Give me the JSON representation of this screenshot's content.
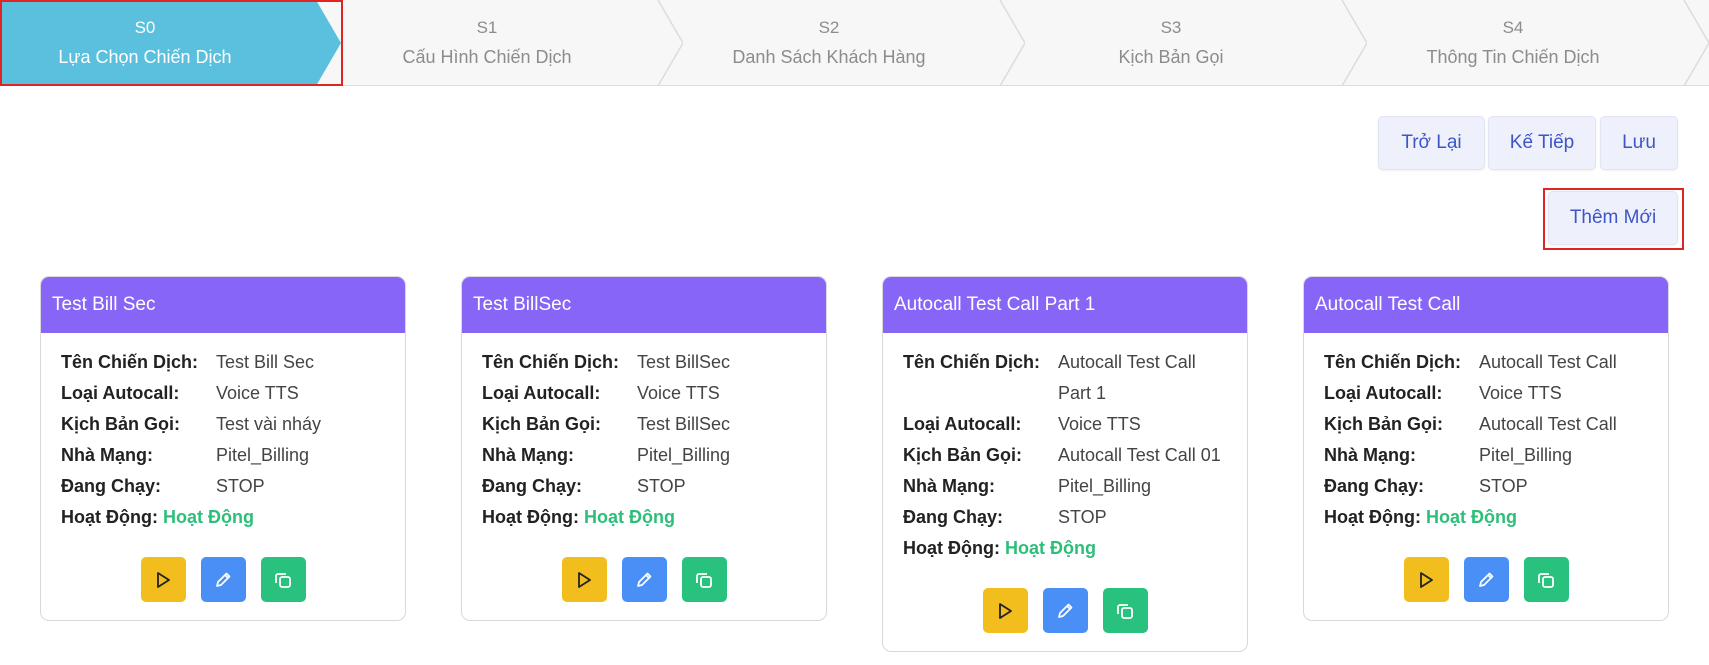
{
  "stepper": {
    "steps": [
      {
        "code": "S0",
        "label": "Lựa Chọn Chiến Dịch"
      },
      {
        "code": "S1",
        "label": "Cấu Hình Chiến Dịch"
      },
      {
        "code": "S2",
        "label": "Danh Sách Khách Hàng"
      },
      {
        "code": "S3",
        "label": "Kịch Bản Gọi"
      },
      {
        "code": "S4",
        "label": "Thông Tin Chiến Dịch"
      }
    ],
    "active_color": "#5bc0de"
  },
  "toolbar": {
    "back_label": "Trở Lại",
    "next_label": "Kế Tiếp",
    "save_label": "Lưu",
    "add_new_label": "Thêm Mới"
  },
  "labels": {
    "name": "Tên Chiến Dịch:",
    "type": "Loại Autocall:",
    "script": "Kịch Bản Gọi:",
    "carrier": "Nhà Mạng:",
    "running": "Đang Chạy:",
    "activity": "Hoạt Động:"
  },
  "campaigns": [
    {
      "title": "Test Bill Sec",
      "name": "Test Bill Sec",
      "type": "Voice TTS",
      "script": "Test vài nháy",
      "carrier": "Pitel_Billing",
      "running": "STOP",
      "activity": "Hoạt Động"
    },
    {
      "title": "Test BillSec",
      "name": "Test BillSec",
      "type": "Voice TTS",
      "script": "Test BillSec",
      "carrier": "Pitel_Billing",
      "running": "STOP",
      "activity": "Hoạt Động"
    },
    {
      "title": "Autocall Test Call Part 1",
      "name": "Autocall Test Call Part 1",
      "type": "Voice TTS",
      "script": "Autocall Test Call 01",
      "carrier": "Pitel_Billing",
      "running": "STOP",
      "activity": "Hoạt Động"
    },
    {
      "title": "Autocall Test Call",
      "name": "Autocall Test Call",
      "type": "Voice TTS",
      "script": "Autocall Test Call",
      "carrier": "Pitel_Billing",
      "running": "STOP",
      "activity": "Hoạt Động"
    }
  ],
  "colors": {
    "card_header": "#8766f7",
    "status_active": "#2dbf7a",
    "play_button": "#f2be1e",
    "edit_button": "#4a8ff5",
    "copy_button": "#28c17e",
    "highlight": "#e02424"
  },
  "icons": {
    "play": "play-icon",
    "edit": "pencil-icon",
    "copy": "copy-icon"
  }
}
